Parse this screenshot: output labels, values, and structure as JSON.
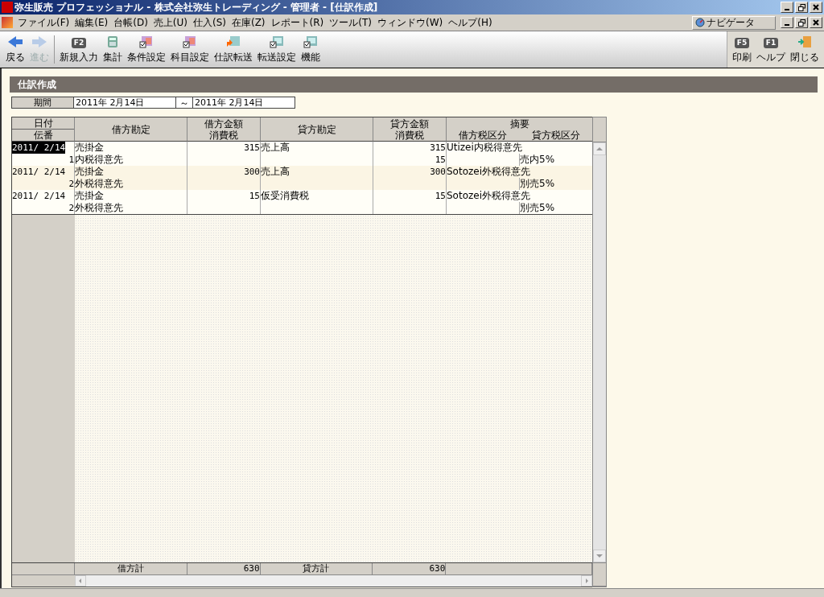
{
  "window": {
    "title": "弥生販売 プロフェッショナル - 株式会社弥生トレーディング - 管理者 - [仕訳作成]"
  },
  "menu": [
    "ファイル(F)",
    "編集(E)",
    "台帳(D)",
    "売上(U)",
    "仕入(S)",
    "在庫(Z)",
    "レポート(R)",
    "ツール(T)",
    "ウィンドウ(W)",
    "ヘルプ(H)"
  ],
  "navigator": {
    "label": "ナビゲータ"
  },
  "toolbar_left": [
    {
      "kind": "back",
      "label": "戻る",
      "disabled": false
    },
    {
      "kind": "forward",
      "label": "進む",
      "disabled": true
    },
    {
      "kind": "fkey",
      "key": "F2",
      "label": "新規入力",
      "disabled": false
    },
    {
      "kind": "calculator",
      "label": "集計",
      "disabled": false
    },
    {
      "kind": "settings",
      "label": "条件設定",
      "disabled": false
    },
    {
      "kind": "settings",
      "label": "科目設定",
      "disabled": false
    },
    {
      "kind": "transfer",
      "label": "仕訳転送",
      "disabled": false
    },
    {
      "kind": "sheet",
      "label": "転送設定",
      "disabled": false
    },
    {
      "kind": "sheet",
      "label": "機能",
      "disabled": false
    }
  ],
  "toolbar_right": [
    {
      "kind": "fkey",
      "key": "F5",
      "label": "印刷"
    },
    {
      "kind": "fkey",
      "key": "F1",
      "label": "ヘルプ"
    },
    {
      "kind": "exit",
      "label": "閉じる"
    }
  ],
  "panel": {
    "title": "仕訳作成"
  },
  "period": {
    "label": "期間",
    "from": "2011年 2月14日",
    "separator": "～",
    "to": "2011年 2月14日"
  },
  "table": {
    "columns": [
      {
        "top": "日付",
        "bottom": "伝番"
      },
      {
        "top": "借方勘定"
      },
      {
        "top": "借方金額",
        "bottom": "消費税"
      },
      {
        "top": "貸方勘定"
      },
      {
        "top": "貸方金額",
        "bottom": "消費税"
      },
      {
        "top": "摘要",
        "sub": [
          "借方税区分",
          "貸方税区分"
        ]
      }
    ],
    "rows": [
      {
        "date": "2011/ 2/14",
        "selected": true,
        "number": "1",
        "debit_account": "売掛金",
        "debit_partner": "内税得意先",
        "debit_amount": "315",
        "credit_account": "売上高",
        "credit_amount": "315",
        "credit_tax": "15",
        "summary": "Utizei内税得意先",
        "credit_tax_class": "売内5%"
      },
      {
        "date": "2011/ 2/14",
        "selected": false,
        "number": "2",
        "debit_account": "売掛金",
        "debit_partner": "外税得意先",
        "debit_amount": "300",
        "credit_account": "売上高",
        "credit_amount": "300",
        "summary": "Sotozei外税得意先",
        "credit_tax_class": "別売5%"
      },
      {
        "date": "2011/ 2/14",
        "selected": false,
        "number": "2",
        "debit_account": "売掛金",
        "debit_partner": "外税得意先",
        "debit_amount": "15",
        "credit_account": "仮受消費税",
        "credit_amount": "15",
        "summary": "Sotozei外税得意先",
        "credit_tax_class": "別売5%"
      }
    ],
    "totals": {
      "debit_label": "借方計",
      "debit_total": "630",
      "credit_label": "貸方計",
      "credit_total": "630"
    }
  }
}
